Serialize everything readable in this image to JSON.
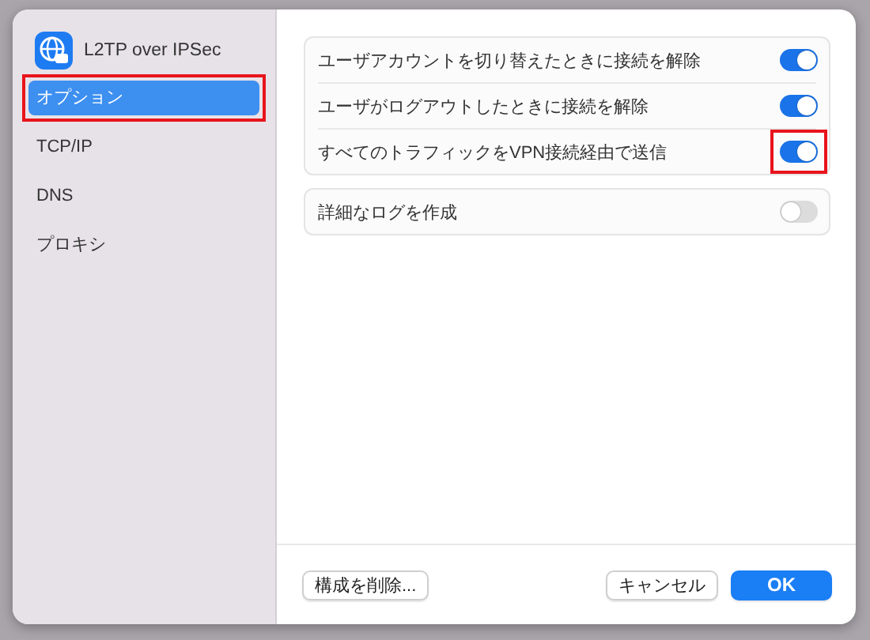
{
  "sidebar": {
    "title": "L2TP over IPSec",
    "items": [
      {
        "label": "オプション",
        "selected": true,
        "highlighted": true
      },
      {
        "label": "TCP/IP",
        "selected": false,
        "highlighted": false
      },
      {
        "label": "DNS",
        "selected": false,
        "highlighted": false
      },
      {
        "label": "プロキシ",
        "selected": false,
        "highlighted": false
      }
    ]
  },
  "option_groups": [
    {
      "options": [
        {
          "label": "ユーザアカウントを切り替えたときに接続を解除",
          "on": true,
          "highlighted": false
        },
        {
          "label": "ユーザがログアウトしたときに接続を解除",
          "on": true,
          "highlighted": false
        },
        {
          "label": "すべてのトラフィックをVPN接続経由で送信",
          "on": true,
          "highlighted": true
        }
      ]
    },
    {
      "options": [
        {
          "label": "詳細なログを作成",
          "on": false,
          "highlighted": false
        }
      ]
    }
  ],
  "buttons": [
    {
      "label": "構成を削除...",
      "kind": "secondary"
    },
    {
      "label": "キャンセル",
      "kind": "secondary"
    },
    {
      "label": "OK",
      "kind": "primary"
    }
  ]
}
